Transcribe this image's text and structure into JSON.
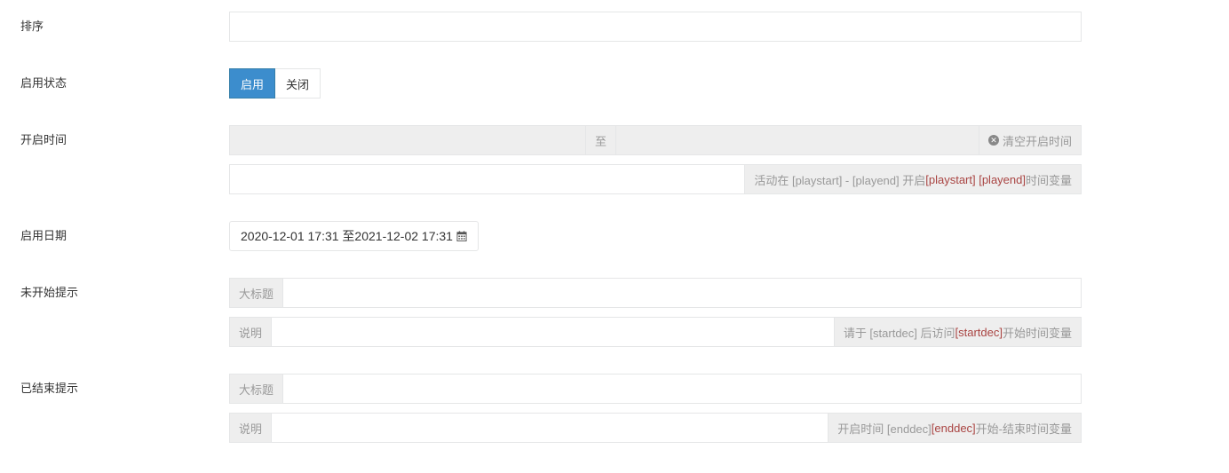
{
  "fields": {
    "sort_label": "排序",
    "status_label": "启用状态",
    "status_on": "启用",
    "status_off": "关闭",
    "time_label": "开启时间",
    "time_to": "至",
    "time_clear": "清空开启时间",
    "time_hint_prefix": "活动在 [playstart] - [playend] 开启 ",
    "time_hint_var": "[playstart] [playend]",
    "time_hint_suffix": "时间变量",
    "date_label": "启用日期",
    "date_value": "2020-12-01 17:31 至2021-12-02 17:31",
    "notstart_label": "未开始提示",
    "notstart_title_addon": "大标题",
    "notstart_desc_addon": "说明",
    "notstart_hint_prefix": "请于 [startdec] 后访问 ",
    "notstart_hint_var": "[startdec]",
    "notstart_hint_suffix": "开始时间变量",
    "ended_label": "已结束提示",
    "ended_title_addon": "大标题",
    "ended_desc_addon": "说明",
    "ended_hint_prefix": "开启时间 [enddec] ",
    "ended_hint_var": "[enddec]",
    "ended_hint_suffix": "开始-结束时间变量"
  },
  "colors": {
    "primary": "#3c8dcd",
    "variable": "#a94442",
    "addon_bg": "#eeeeee"
  },
  "icons": {
    "clear": "times-circle-icon",
    "calendar": "calendar-icon"
  }
}
